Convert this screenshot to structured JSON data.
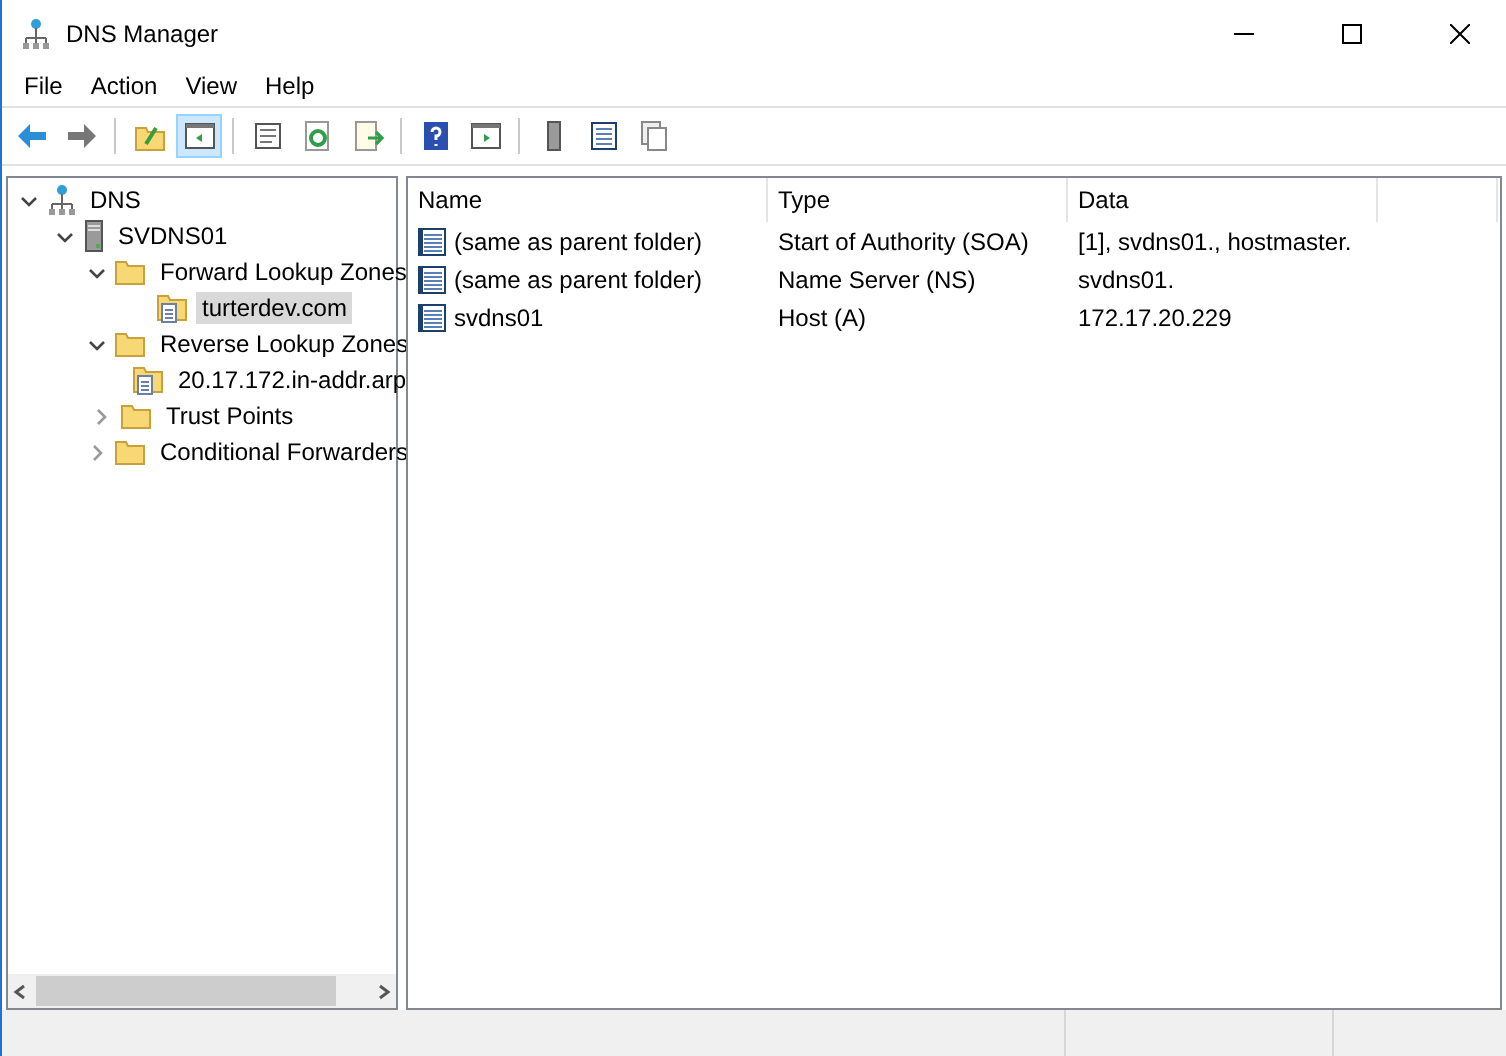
{
  "window": {
    "title": "DNS Manager"
  },
  "menu": [
    "File",
    "Action",
    "View",
    "Help"
  ],
  "toolbar": [
    [
      {
        "kind": "back",
        "pressed": false
      },
      {
        "kind": "forward",
        "pressed": false
      }
    ],
    [
      {
        "kind": "up",
        "pressed": false
      },
      {
        "kind": "tree",
        "pressed": true
      }
    ],
    [
      {
        "kind": "properties",
        "pressed": false
      },
      {
        "kind": "refresh",
        "pressed": false
      },
      {
        "kind": "export",
        "pressed": false
      }
    ],
    [
      {
        "kind": "help",
        "pressed": false
      },
      {
        "kind": "action-pane",
        "pressed": false
      }
    ],
    [
      {
        "kind": "server",
        "pressed": false
      },
      {
        "kind": "list",
        "pressed": false
      },
      {
        "kind": "copy",
        "pressed": false
      }
    ]
  ],
  "tree": [
    {
      "label": "DNS",
      "kind": "dns",
      "selected": false,
      "expanded": true,
      "children": [
        {
          "label": "SVDNS01",
          "kind": "server",
          "selected": false,
          "expanded": true,
          "children": [
            {
              "label": "Forward Lookup Zones",
              "kind": "folder",
              "selected": false,
              "expanded": true,
              "children": [
                {
                  "label": "turterdev.com",
                  "kind": "zone",
                  "selected": true
                }
              ]
            },
            {
              "label": "Reverse Lookup Zones",
              "kind": "folder",
              "selected": false,
              "expanded": true,
              "children": [
                {
                  "label": "20.17.172.in-addr.arp",
                  "kind": "zone",
                  "selected": false
                }
              ]
            },
            {
              "label": "Trust Points",
              "kind": "folder",
              "selected": false,
              "expanded": false
            },
            {
              "label": "Conditional Forwarders",
              "kind": "folder",
              "selected": false,
              "expanded": false
            }
          ]
        }
      ]
    }
  ],
  "table": {
    "columns": [
      "Name",
      "Type",
      "Data"
    ],
    "rows": [
      {
        "cells": [
          "(same as parent folder)",
          "Start of Authority (SOA)",
          "[1], svdns01., hostmaster."
        ],
        "selected": false
      },
      {
        "cells": [
          "(same as parent folder)",
          "Name Server (NS)",
          "svdns01."
        ],
        "selected": false
      },
      {
        "cells": [
          "svdns01",
          "Host (A)",
          "172.17.20.229"
        ],
        "selected": false
      }
    ]
  }
}
